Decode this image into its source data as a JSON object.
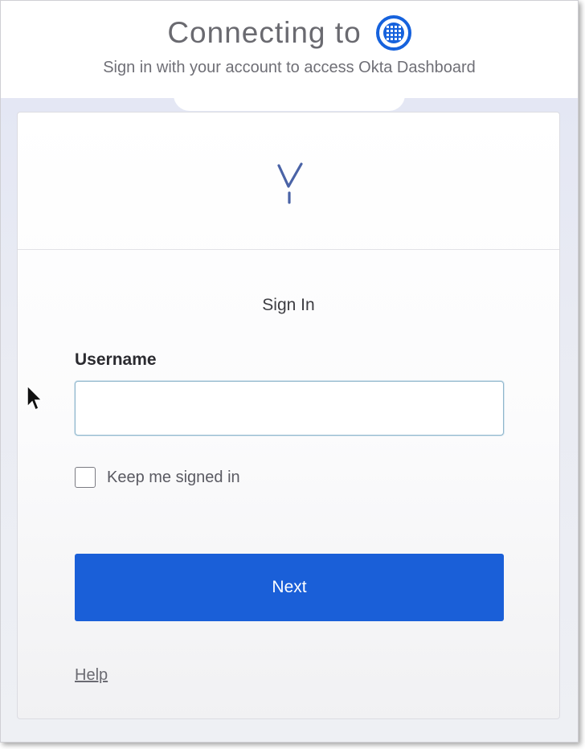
{
  "header": {
    "connecting_text": "Connecting to",
    "subtitle": "Sign in with your account to access Okta Dashboard",
    "org_icon": "building-grid-icon"
  },
  "card": {
    "logo_icon": "brand-y-logo-icon",
    "title": "Sign In",
    "username": {
      "label": "Username",
      "value": "",
      "placeholder": ""
    },
    "keep_signed_in": {
      "label": "Keep me signed in",
      "checked": false
    },
    "next_label": "Next",
    "help_label": "Help"
  },
  "colors": {
    "primary_button": "#1a5fd8",
    "org_icon": "#1662dd",
    "logo": "#4a63a6",
    "background_band": "#e4e7f4"
  }
}
